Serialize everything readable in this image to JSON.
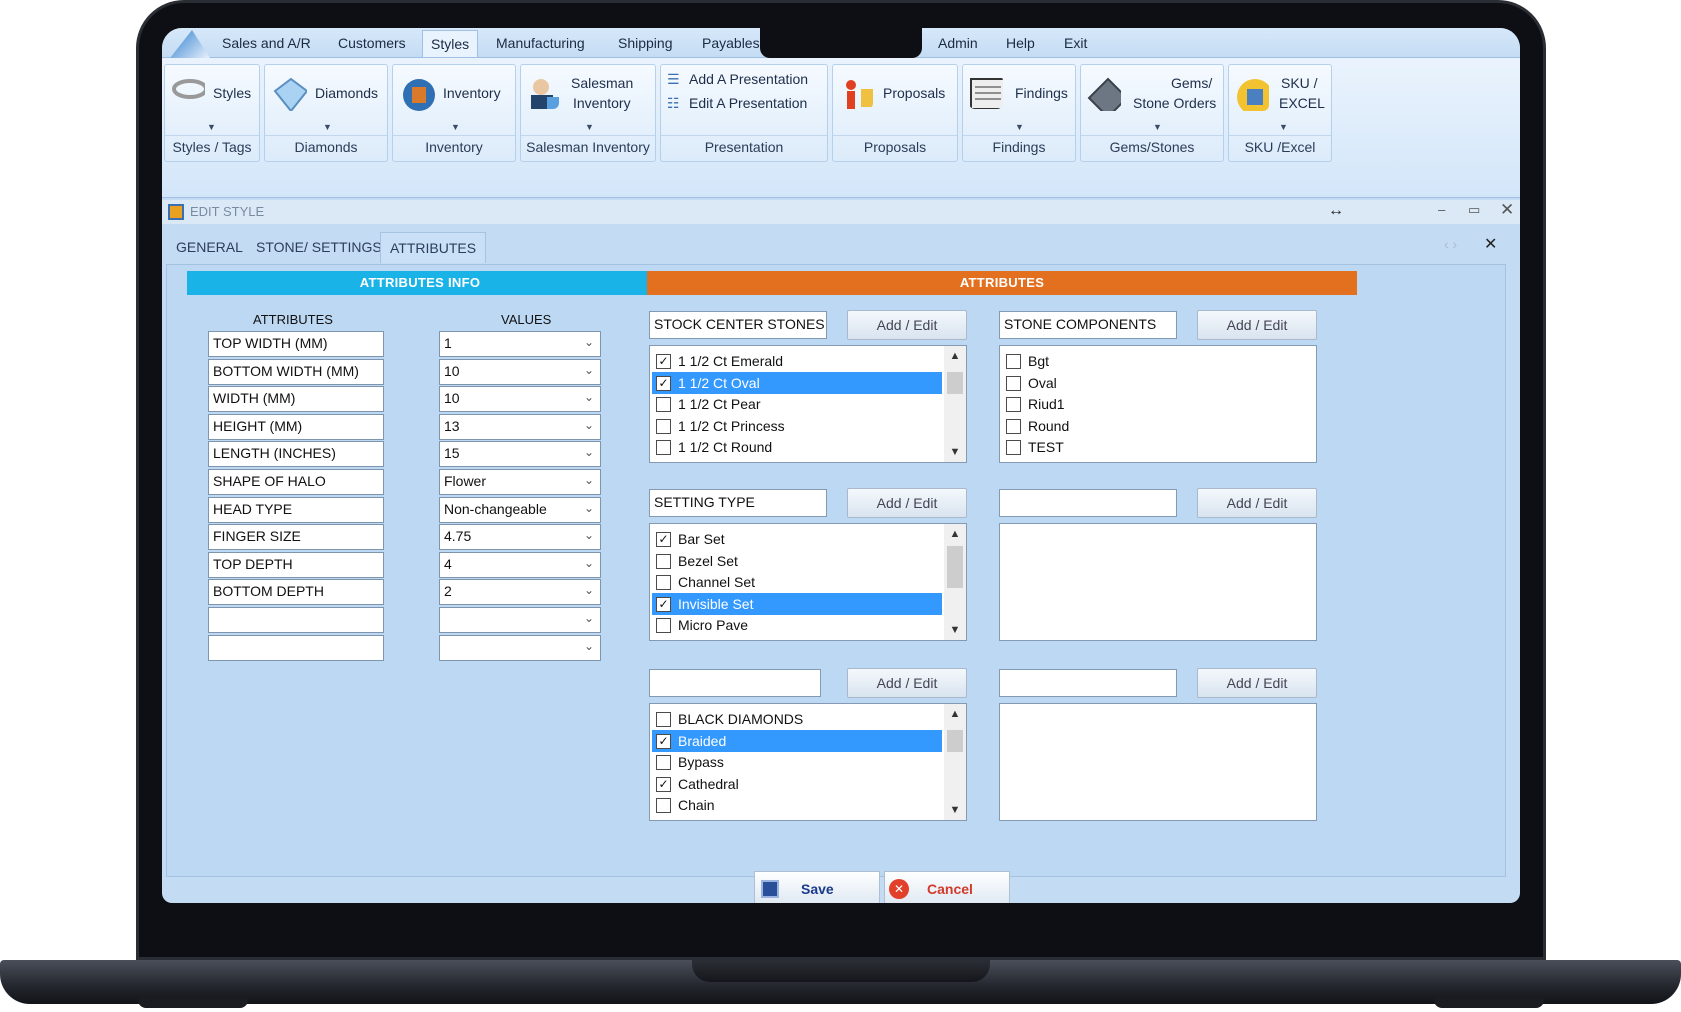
{
  "menu": {
    "items": [
      "Sales and A/R",
      "Customers",
      "Styles",
      "Manufacturing",
      "Shipping",
      "Payables",
      "Admin",
      "Help",
      "Exit"
    ],
    "active": "Styles"
  },
  "ribbon": {
    "styles_btn": "Styles",
    "styles_group": "Styles / Tags",
    "diamonds_btn": "Diamonds",
    "diamonds_group": "Diamonds",
    "inventory_btn": "Inventory",
    "inventory_group": "Inventory",
    "salesman_btn_1": "Salesman",
    "salesman_btn_2": "Inventory",
    "salesman_group": "Salesman Inventory",
    "add_presentation": "Add A Presentation",
    "edit_presentation": "Edit A Presentation",
    "presentation_group": "Presentation",
    "proposals_btn": "Proposals",
    "proposals_group": "Proposals",
    "findings_btn": "Findings",
    "findings_group": "Findings",
    "gems_btn_1": "Gems/",
    "gems_btn_2": "Stone Orders",
    "gems_group": "Gems/Stones",
    "sku_btn_1": "SKU /",
    "sku_btn_2": "EXCEL",
    "sku_group": "SKU /Excel"
  },
  "window": {
    "title": "EDIT STYLE",
    "tabs": [
      "GENERAL",
      "STONE/ SETTINGS",
      "ATTRIBUTES"
    ],
    "active_tab": "ATTRIBUTES"
  },
  "attributes_info": {
    "header": "ATTRIBUTES  INFO",
    "col_attributes": "ATTRIBUTES",
    "col_values": "VALUES",
    "rows": [
      {
        "attr": "TOP WIDTH (MM)",
        "value": "1"
      },
      {
        "attr": "BOTTOM WIDTH (MM)",
        "value": "10"
      },
      {
        "attr": "WIDTH (MM)",
        "value": "10"
      },
      {
        "attr": "HEIGHT (MM)",
        "value": "13"
      },
      {
        "attr": "LENGTH (INCHES)",
        "value": "15"
      },
      {
        "attr": "SHAPE OF HALO",
        "value": "Flower"
      },
      {
        "attr": "HEAD TYPE",
        "value": "Non-changeable"
      },
      {
        "attr": "FINGER SIZE",
        "value": "4.75"
      },
      {
        "attr": "TOP DEPTH",
        "value": "4"
      },
      {
        "attr": "BOTTOM DEPTH",
        "value": "2"
      },
      {
        "attr": "",
        "value": ""
      },
      {
        "attr": "",
        "value": ""
      }
    ]
  },
  "attributes": {
    "header": "ATTRIBUTES",
    "add_edit_label": "Add / Edit",
    "panels": [
      {
        "title": "STOCK CENTER STONES",
        "items": [
          {
            "label": "1 1/2 Ct Emerald",
            "checked": true,
            "selected": false
          },
          {
            "label": "1 1/2 Ct Oval",
            "checked": true,
            "selected": true
          },
          {
            "label": "1 1/2 Ct Pear",
            "checked": false,
            "selected": false
          },
          {
            "label": "1 1/2 Ct Princess",
            "checked": false,
            "selected": false
          },
          {
            "label": "1 1/2 Ct Round",
            "checked": false,
            "selected": false
          }
        ],
        "scroll": true
      },
      {
        "title": "STONE COMPONENTS",
        "items": [
          {
            "label": "Bgt",
            "checked": false,
            "selected": false
          },
          {
            "label": "Oval",
            "checked": false,
            "selected": false
          },
          {
            "label": "Riud1",
            "checked": false,
            "selected": false
          },
          {
            "label": "Round",
            "checked": false,
            "selected": false
          },
          {
            "label": "TEST",
            "checked": false,
            "selected": false
          }
        ],
        "scroll": false
      },
      {
        "title": "SETTING TYPE",
        "items": [
          {
            "label": "Bar Set",
            "checked": true,
            "selected": false
          },
          {
            "label": "Bezel Set",
            "checked": false,
            "selected": false
          },
          {
            "label": "Channel Set",
            "checked": false,
            "selected": false
          },
          {
            "label": "Invisible Set",
            "checked": true,
            "selected": true
          },
          {
            "label": "Micro Pave",
            "checked": false,
            "selected": false
          }
        ],
        "scroll": true
      },
      {
        "title": "",
        "items": [],
        "scroll": false
      },
      {
        "title": "",
        "items": [
          {
            "label": "BLACK DIAMONDS",
            "checked": false,
            "selected": false
          },
          {
            "label": "Braided",
            "checked": true,
            "selected": true
          },
          {
            "label": "Bypass",
            "checked": false,
            "selected": false
          },
          {
            "label": "Cathedral",
            "checked": true,
            "selected": false
          },
          {
            "label": "Chain",
            "checked": false,
            "selected": false
          }
        ],
        "scroll": true
      },
      {
        "title": "",
        "items": [],
        "scroll": false
      }
    ]
  },
  "buttons": {
    "save": "Save",
    "cancel": "Cancel"
  },
  "colors": {
    "info_header": "#1ab3e8",
    "attributes_header": "#e2701f",
    "selection": "#3399ff"
  }
}
